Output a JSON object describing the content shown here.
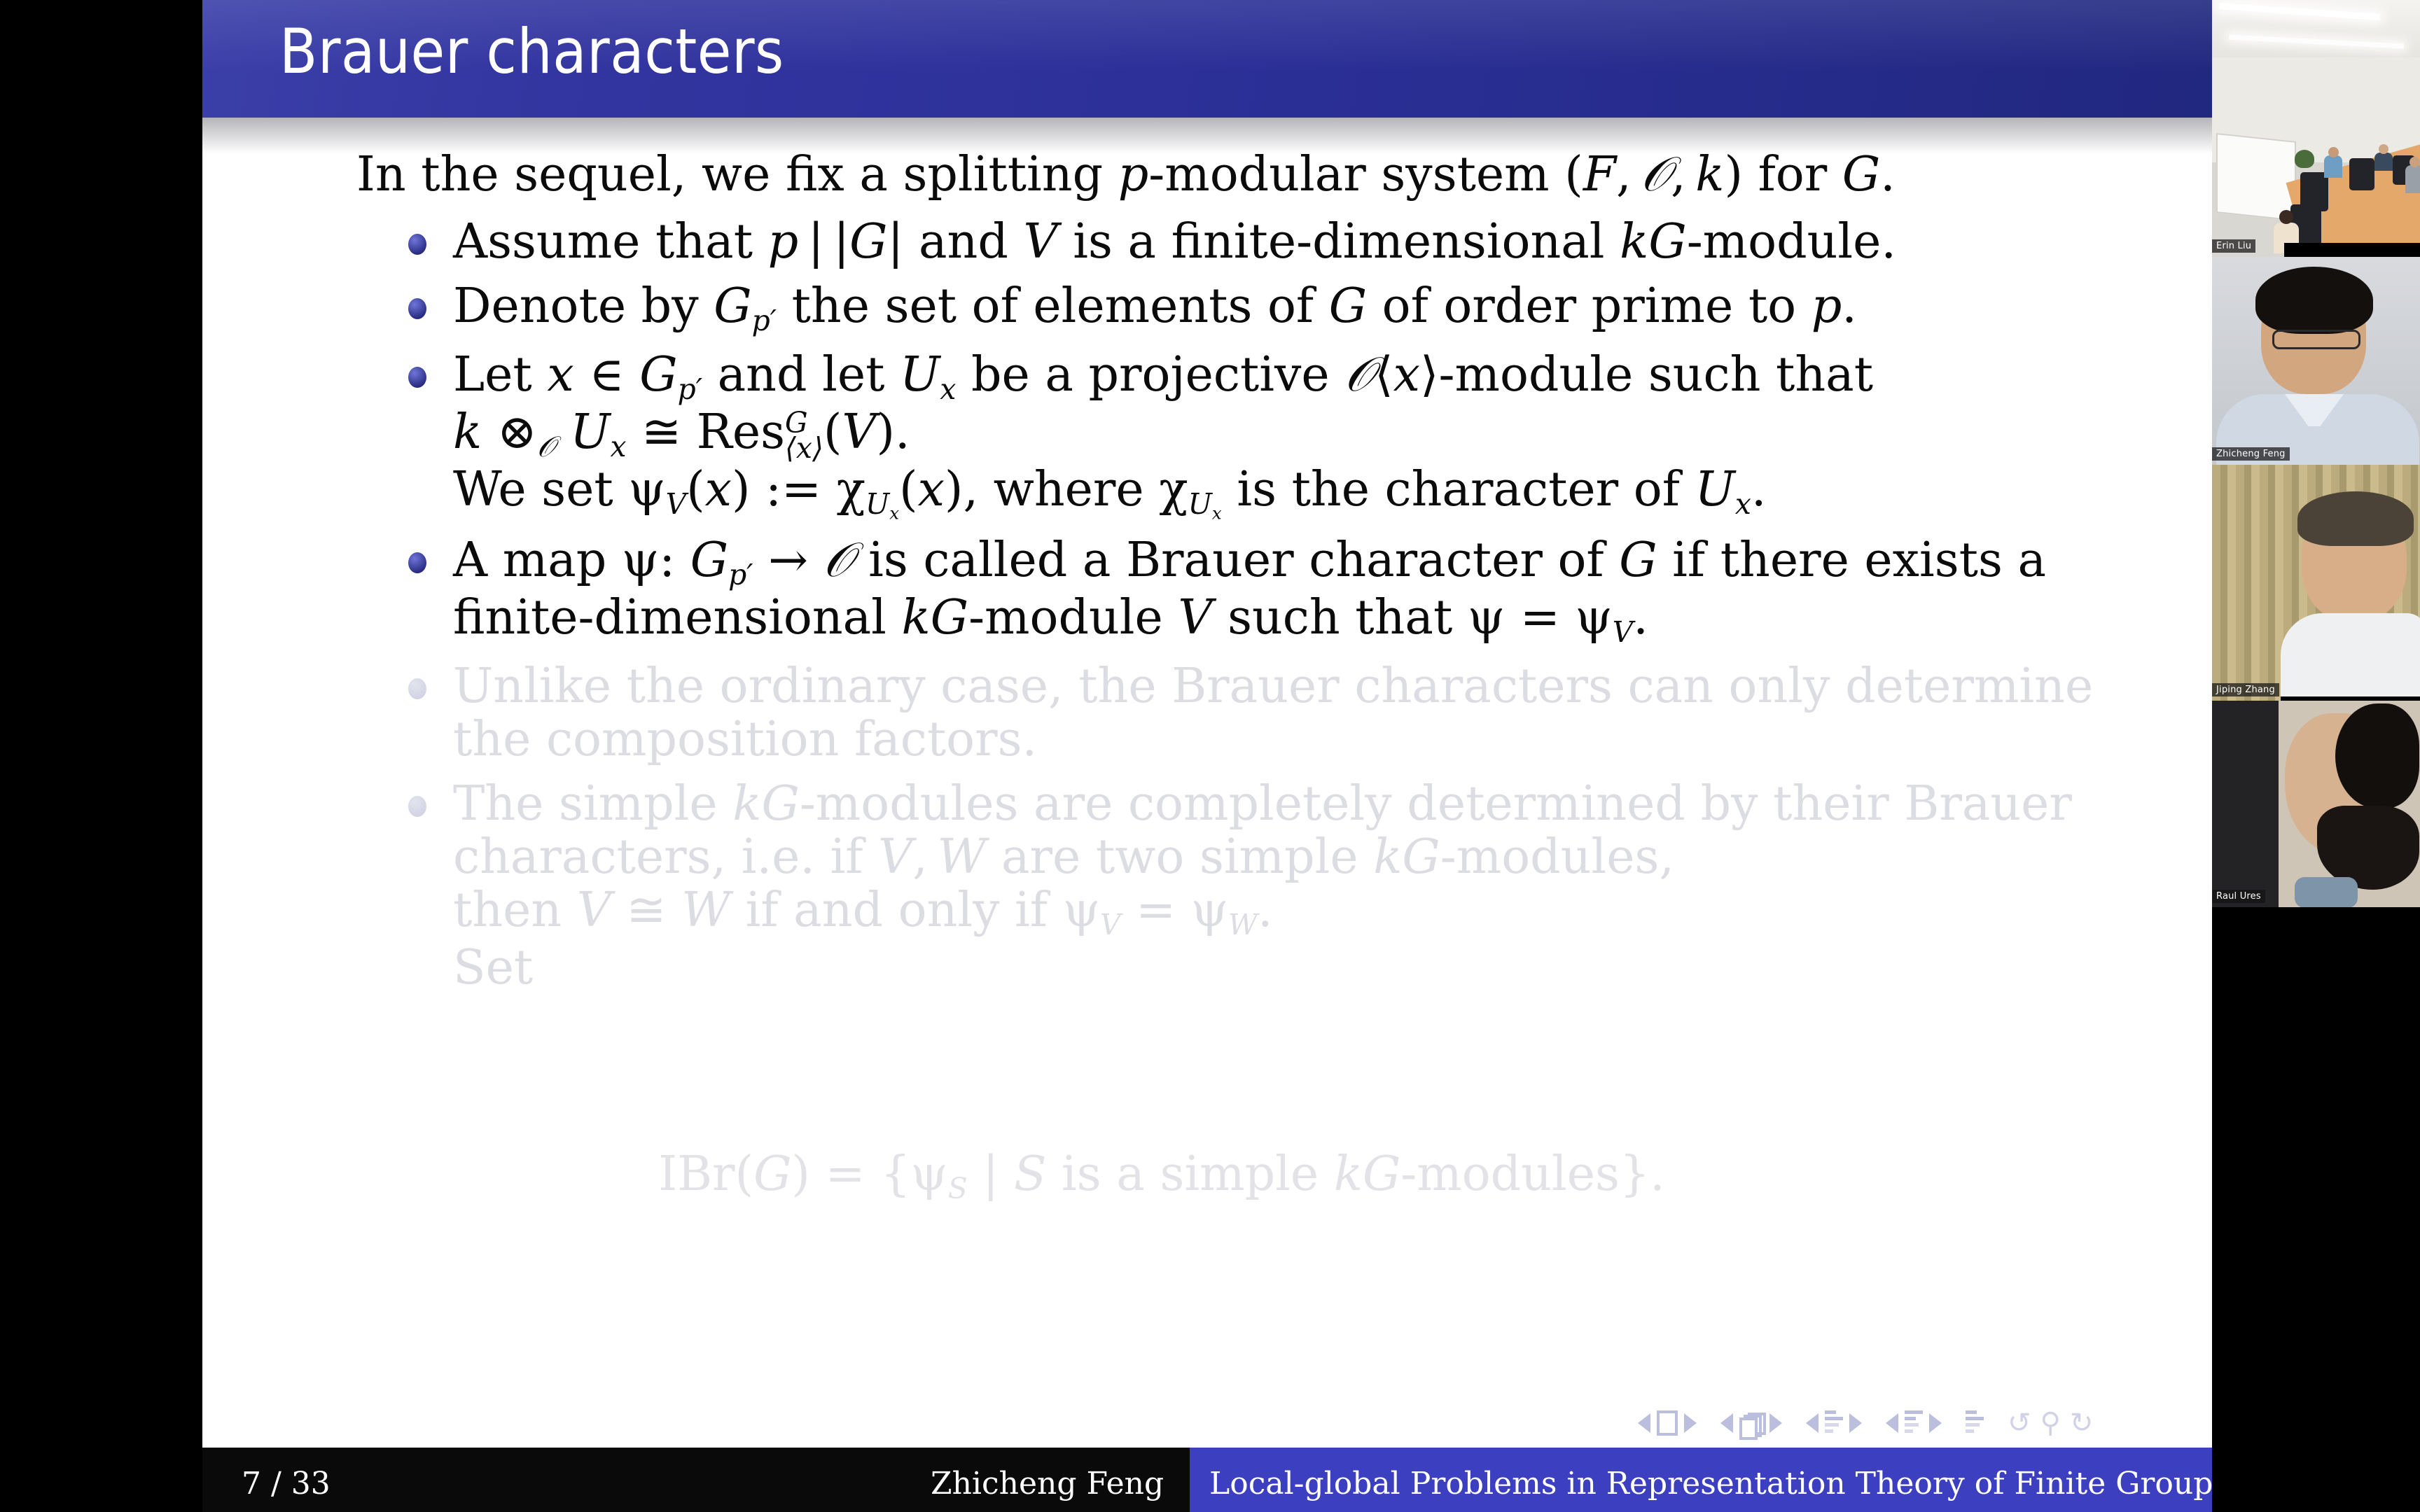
{
  "slide": {
    "title": "Brauer characters",
    "lead": "In the sequel, we fix a splitting p-modular system (F, O, k) for G.",
    "bullets": [
      {
        "id": "assume-p-divides",
        "dim": false,
        "text": "Assume that p | |G| and V is a finite-dimensional kG-module."
      },
      {
        "id": "denote-gp-prime",
        "dim": false,
        "text": "Denote by Gp' the set of elements of G of order prime to p."
      },
      {
        "id": "let-x-in-gp-prime",
        "dim": false,
        "text": "Let x ∈ Gp' and let Ux be a projective O<x>-module such that k ⊗O Ux ≅ Res^G_<x>(V).",
        "line2": "We set ψV(x) := χUx(x), where χUx is the character of Ux."
      },
      {
        "id": "brauer-character-definition",
        "dim": false,
        "text": "A map ψ: Gp' → O is called a Brauer character of G if there exists a finite-dimensional kG-module V such that ψ = ψV."
      },
      {
        "id": "unlike-ordinary-case",
        "dim": true,
        "text": "Unlike the ordinary case, the Brauer characters can only determine the composition factors."
      },
      {
        "id": "simple-modules-determined",
        "dim": true,
        "text": "The simple kG-modules are completely determined by their Brauer characters, i.e. if V, W are two simple kG-modules, then V ≅ W if and only if ψV = ψW.",
        "line4": "Set"
      }
    ],
    "display_equation": "IBr(G) = {ψS | S is a simple kG-modules}.",
    "nav_symbols": [
      "prev-slide",
      "slide-icon",
      "next-slide",
      "prev-frame",
      "frames-icon",
      "next-frame",
      "prev-subsection",
      "subsection-icon",
      "next-subsection",
      "prev-section",
      "section-icon",
      "next-section",
      "doc-icon",
      "back-icon",
      "search-icon",
      "forward-icon"
    ]
  },
  "footer": {
    "page": "7 / 33",
    "author": "Zhicheng Feng",
    "talk": "Local-global Problems in Representation Theory of Finite Groups"
  },
  "video_panel": {
    "participants": [
      {
        "name": "Erin Liu"
      },
      {
        "name": "Zhicheng Feng"
      },
      {
        "name": "Jiping Zhang"
      },
      {
        "name": "Raul Ures"
      }
    ]
  },
  "colors": {
    "title_bar": "#2a2f96",
    "footer_accent": "#3b3fc0",
    "bullet_dot": "#2b2f86",
    "dim_text": "#dcdce3",
    "body_text": "#0b0b0b"
  }
}
